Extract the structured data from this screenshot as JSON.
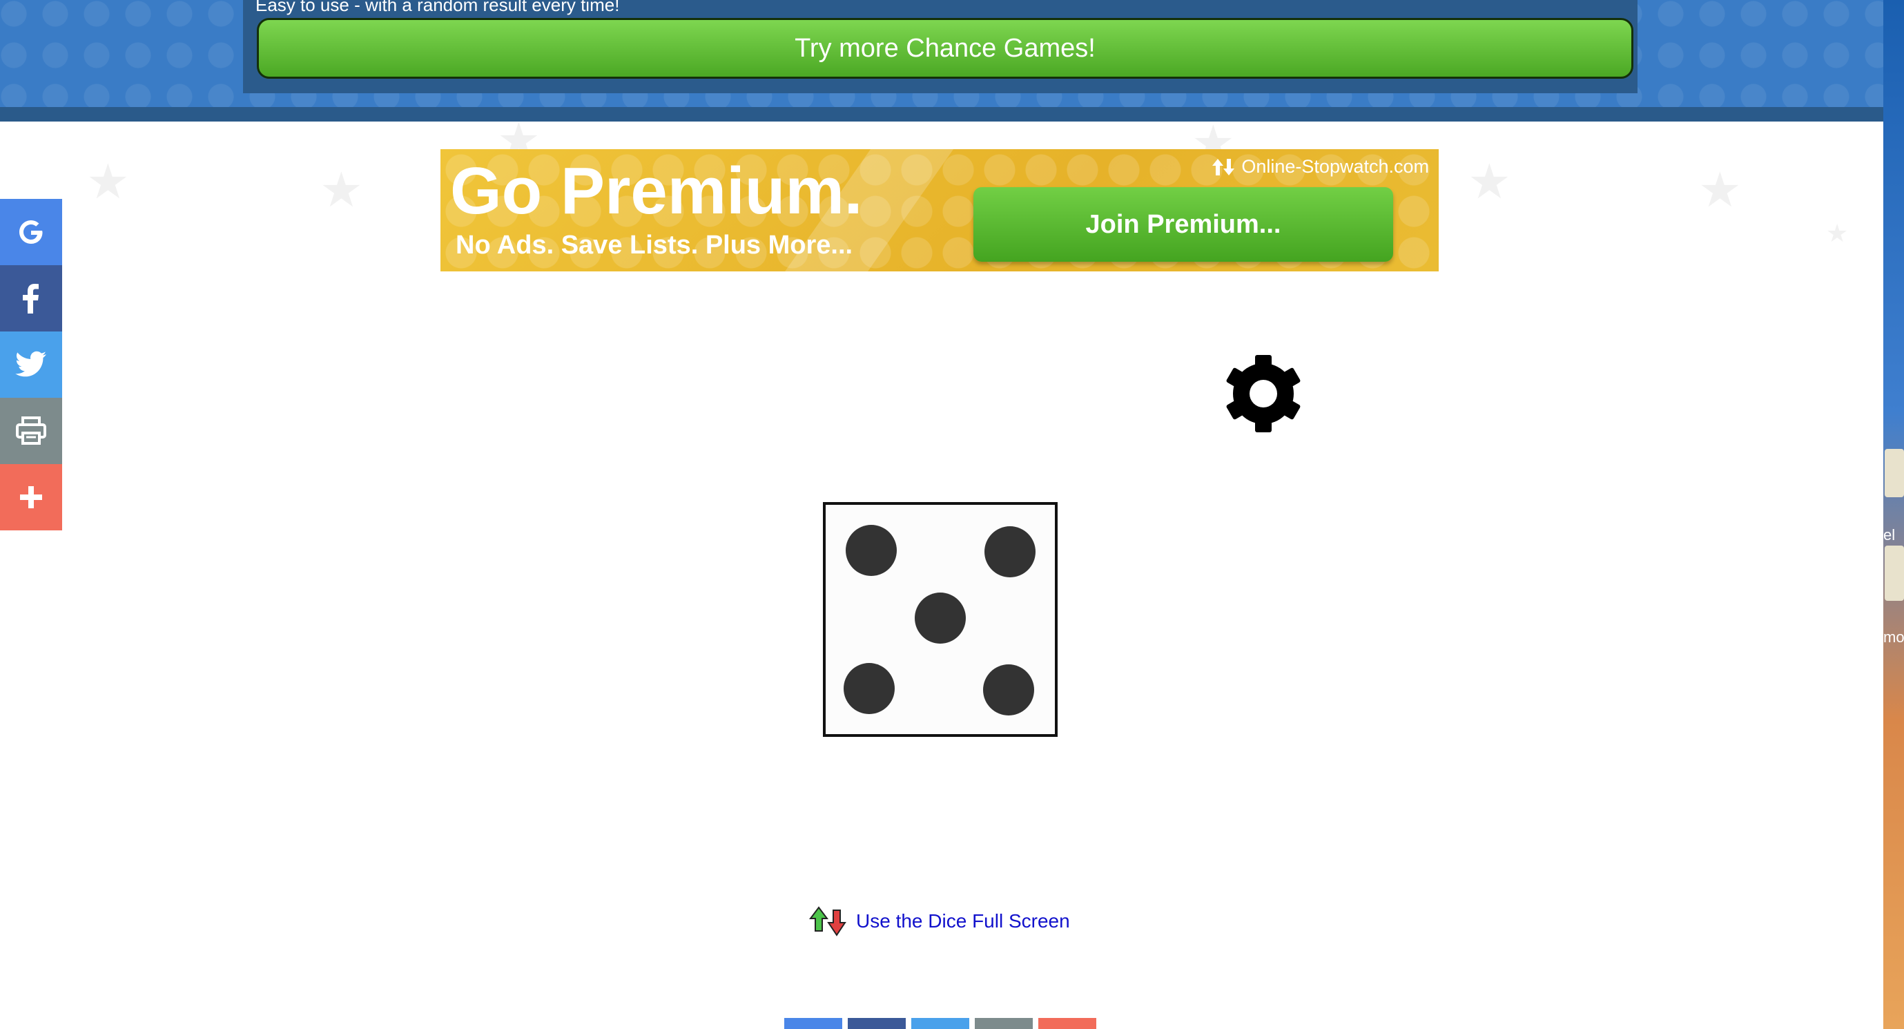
{
  "header": {
    "tagline": "Easy to use - with a random result every time!",
    "try_button": "Try more Chance Games!"
  },
  "premium_ad": {
    "title": "Go Premium.",
    "subtitle": "No Ads. Save Lists. Plus More...",
    "brand": "Online-Stopwatch.com",
    "join_button": "Join Premium..."
  },
  "social": {
    "items": [
      {
        "icon": "google-icon",
        "glyph": "G",
        "color": "#4a86e8"
      },
      {
        "icon": "facebook-icon",
        "glyph": "f",
        "color": "#3b5998"
      },
      {
        "icon": "twitter-icon",
        "glyph": "•",
        "color": "#4aa1eb"
      },
      {
        "icon": "print-icon",
        "glyph": "⎙",
        "color": "#7d8b8c"
      },
      {
        "icon": "more-icon",
        "glyph": "+",
        "color": "#f26c5a"
      }
    ]
  },
  "dice": {
    "value": 5
  },
  "fullscreen_link": "Use the Dice Full Screen",
  "right_edge": {
    "text_1": "el",
    "text_2": "mo"
  },
  "colors": {
    "header_blue": "#3a7cc6",
    "green_button": "#5cbf2a",
    "premium_gold": "#e6b229"
  }
}
